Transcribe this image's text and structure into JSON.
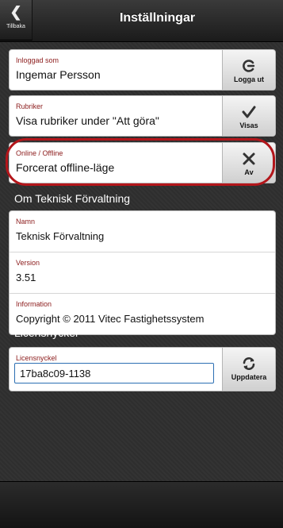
{
  "header": {
    "title": "Inställningar",
    "back_label": "Tillbaka"
  },
  "login": {
    "label": "Inloggad som",
    "value": "Ingemar Persson",
    "button": "Logga ut",
    "icon": "logout-icon"
  },
  "headings": {
    "label": "Rubriker",
    "value": "Visa rubriker under \"Att göra\"",
    "button": "Visas",
    "icon": "check-icon"
  },
  "online": {
    "label": "Online / Offline",
    "value": "Forcerat offline-läge",
    "button": "Av",
    "icon": "x-icon"
  },
  "about": {
    "heading": "Om Teknisk Förvaltning",
    "rows": [
      {
        "label": "Namn",
        "value": "Teknisk Förvaltning"
      },
      {
        "label": "Version",
        "value": "3.51"
      },
      {
        "label": "Information",
        "value": "Copyright © 2011 Vitec Fastighetssystem"
      }
    ]
  },
  "license": {
    "heading": "Licensnyckel",
    "label": "Licensnyckel",
    "value": "17ba8c09-1138",
    "button": "Uppdatera",
    "icon": "refresh-icon"
  },
  "colors": {
    "highlight": "#b3161b",
    "label": "#8b1a1a",
    "input_border": "#2c6fb3"
  }
}
